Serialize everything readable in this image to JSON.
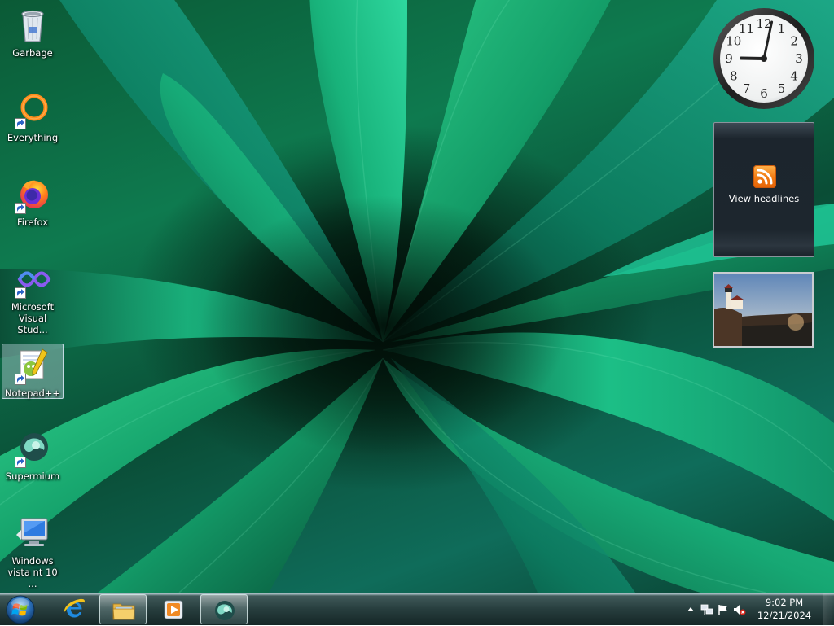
{
  "desktop": {
    "icons": [
      {
        "label": "Garbage",
        "icon": "recycle-bin-icon",
        "shortcut": false,
        "selected": false
      },
      {
        "label": "Everything",
        "icon": "everything-icon",
        "shortcut": true,
        "selected": false
      },
      {
        "label": "Firefox",
        "icon": "firefox-icon",
        "shortcut": true,
        "selected": false
      },
      {
        "label": "Microsoft Visual Stud...",
        "icon": "visual-studio-icon",
        "shortcut": true,
        "selected": false
      },
      {
        "label": "Notepad++",
        "icon": "notepad-plus-plus-icon",
        "shortcut": true,
        "selected": true
      },
      {
        "label": "Supermium",
        "icon": "supermium-icon",
        "shortcut": true,
        "selected": false
      },
      {
        "label": "Windows vista nt 10 ...",
        "icon": "computer-monitor-icon",
        "shortcut": false,
        "selected": false
      }
    ]
  },
  "gadgets": {
    "clock": {
      "hour": 9,
      "minute": 2,
      "numerals": [
        "12",
        "1",
        "2",
        "3",
        "4",
        "5",
        "6",
        "7",
        "8",
        "9",
        "10",
        "11"
      ]
    },
    "feed": {
      "label": "View headlines",
      "icon": "rss-feed-icon"
    },
    "slideshow": {
      "icon": "lighthouse-photo"
    }
  },
  "taskbar": {
    "start": {
      "icon": "windows-start-orb-icon"
    },
    "pinned": [
      {
        "icon": "internet-explorer-icon",
        "active": false
      },
      {
        "icon": "file-explorer-icon",
        "active": true
      },
      {
        "icon": "media-player-icon",
        "active": false
      },
      {
        "icon": "supermium-icon",
        "active": true
      }
    ],
    "tray": {
      "icons": [
        "show-hidden-icons-icon",
        "network-icon",
        "action-center-flag-icon",
        "volume-muted-icon"
      ],
      "time": "9:02 PM",
      "date": "12/21/2024"
    }
  },
  "colors": {
    "taskbar": "#143030",
    "accent": "#0e7a4f",
    "feed_orange": "#f07a12"
  }
}
